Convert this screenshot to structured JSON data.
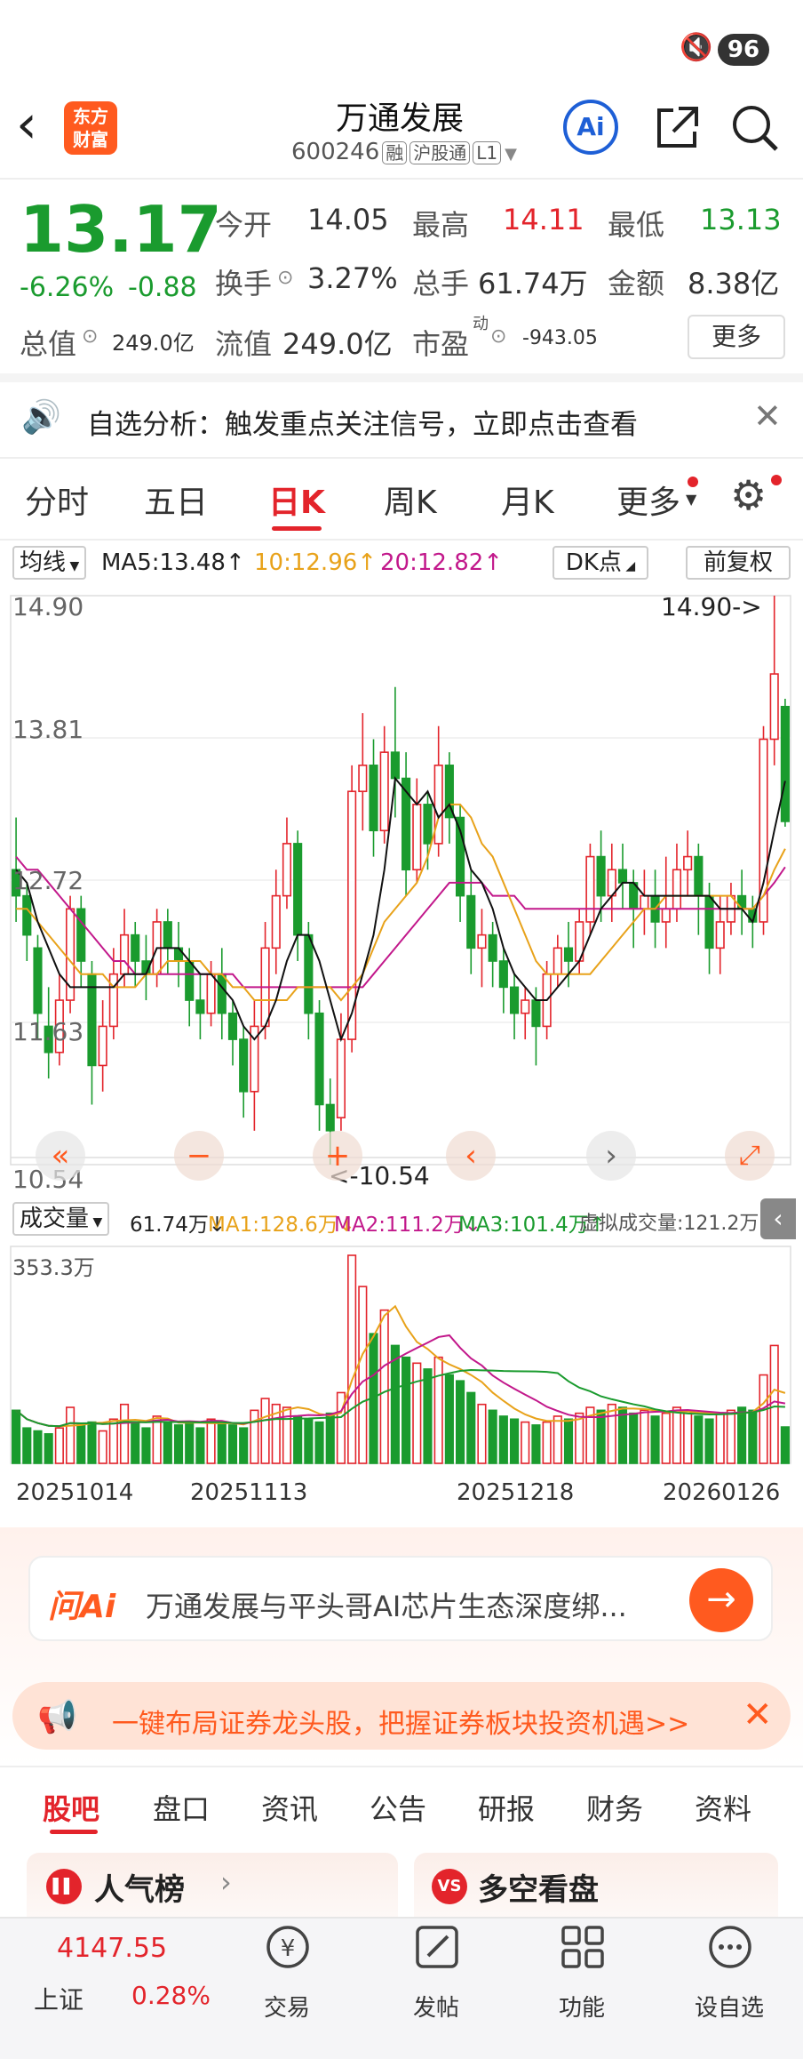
{
  "status": {
    "battery": "96"
  },
  "header": {
    "title": "万通发展",
    "code": "600246",
    "tags": [
      "融",
      "沪股通",
      "L1"
    ],
    "logo_line1": "东方",
    "logo_line2": "财富"
  },
  "quote": {
    "price": "13.17",
    "pct": "-6.26%",
    "chg": "-0.88",
    "open_label": "今开",
    "open": "14.05",
    "high_label": "最高",
    "high": "14.11",
    "low_label": "最低",
    "low": "13.13",
    "turnover_label": "换手",
    "turnover": "3.27%",
    "volume_label": "总手",
    "volume": "61.74万",
    "amount_label": "金额",
    "amount": "8.38亿",
    "mktcap_label": "总值",
    "mktcap": "249.0亿",
    "float_label": "流值",
    "float": "249.0亿",
    "pe_label": "市盈",
    "pe_sup": "动",
    "pe": "-943.05",
    "more_label": "更多"
  },
  "notice": {
    "text": "自选分析：触发重点关注信号，立即点击查看"
  },
  "tabs": [
    "分时",
    "五日",
    "日K",
    "周K",
    "月K",
    "更多"
  ],
  "active_tab": 2,
  "ma_bar": {
    "type": "均线",
    "ma5": "MA5:13.48↑",
    "ma10": "10:12.96↑",
    "ma20": "20:12.82↑",
    "dk": "DK点",
    "fq": "前复权"
  },
  "chart_labels": {
    "top": "14.90",
    "l2": "13.81",
    "l3": "12.72",
    "l4": "11.63",
    "bottom": "10.54",
    "max_note": "14.90->",
    "min_note": "<-10.54"
  },
  "vol_bar": {
    "type": "成交量",
    "vol": "61.74万↓",
    "ma1": "MA1:128.6万↓",
    "ma2": "MA2:111.2万↓",
    "ma3": "MA3:101.4万↑",
    "virtual": "虚拟成交量:121.2万",
    "max": "353.3万"
  },
  "dates": [
    "20251014",
    "20251113",
    "20251218",
    "20260126"
  ],
  "colors": {
    "up": "#e3242b",
    "down": "#1a9b2e",
    "ma5": "#111111",
    "ma10": "#e8a21a",
    "ma20": "#c2188b",
    "ma60": "#1a9b2e",
    "accent": "#ff5a1f"
  },
  "ai_box": {
    "logo": "问Ai",
    "text": "万通发展与平头哥AI芯片生态深度绑..."
  },
  "promo": {
    "text": "一键布局证券龙头股，把握证券板块投资机遇>>"
  },
  "bottom_tabs": [
    "股吧",
    "盘口",
    "资讯",
    "公告",
    "研报",
    "财务",
    "资料"
  ],
  "cards": [
    {
      "label": "人气榜",
      "icon_text": "▌▌"
    },
    {
      "label": "多空看盘",
      "icon_text": "VS"
    }
  ],
  "nav": {
    "index_value": "4147.55",
    "index_name": "上证",
    "index_pct": "0.28%",
    "items": [
      "交易",
      "发帖",
      "功能",
      "设自选"
    ]
  },
  "chart_data": {
    "type": "candlestick",
    "ylim": [
      10.54,
      14.9
    ],
    "candles": [
      [
        12.8,
        12.6,
        13.2,
        12.4
      ],
      [
        12.6,
        12.3,
        12.7,
        12.1
      ],
      [
        12.2,
        11.7,
        12.3,
        11.5
      ],
      [
        11.6,
        11.4,
        11.9,
        11.2
      ],
      [
        11.4,
        11.8,
        12.0,
        11.3
      ],
      [
        11.8,
        12.5,
        12.6,
        11.7
      ],
      [
        12.5,
        12.1,
        12.6,
        11.9
      ],
      [
        12.0,
        11.3,
        12.1,
        11.0
      ],
      [
        11.3,
        11.6,
        11.8,
        11.1
      ],
      [
        11.6,
        12.0,
        12.2,
        11.5
      ],
      [
        12.0,
        12.3,
        12.5,
        11.9
      ],
      [
        12.3,
        12.1,
        12.4,
        11.9
      ],
      [
        12.1,
        12.0,
        12.3,
        11.8
      ],
      [
        12.0,
        12.4,
        12.5,
        11.9
      ],
      [
        12.4,
        12.2,
        12.5,
        12.0
      ],
      [
        12.2,
        12.1,
        12.4,
        11.9
      ],
      [
        12.1,
        11.8,
        12.2,
        11.6
      ],
      [
        11.8,
        11.7,
        12.0,
        11.5
      ],
      [
        11.7,
        12.0,
        12.1,
        11.6
      ],
      [
        12.0,
        11.7,
        12.2,
        11.5
      ],
      [
        11.7,
        11.5,
        11.8,
        11.3
      ],
      [
        11.5,
        11.1,
        11.6,
        10.9
      ],
      [
        11.1,
        11.6,
        11.8,
        10.8
      ],
      [
        11.6,
        12.2,
        12.4,
        11.5
      ],
      [
        12.2,
        12.6,
        12.8,
        12.0
      ],
      [
        12.6,
        13.0,
        13.2,
        12.5
      ],
      [
        13.0,
        12.3,
        13.1,
        12.1
      ],
      [
        12.3,
        11.7,
        12.4,
        11.5
      ],
      [
        11.7,
        11.0,
        11.8,
        10.8
      ],
      [
        11.0,
        10.8,
        11.2,
        10.54
      ],
      [
        10.9,
        11.5,
        11.7,
        10.8
      ],
      [
        11.5,
        13.4,
        13.6,
        11.4
      ],
      [
        13.4,
        13.6,
        14.0,
        13.1
      ],
      [
        13.6,
        13.1,
        13.8,
        12.9
      ],
      [
        13.1,
        13.7,
        13.9,
        13.0
      ],
      [
        13.7,
        13.5,
        14.2,
        13.2
      ],
      [
        13.5,
        12.8,
        13.7,
        12.6
      ],
      [
        12.8,
        13.3,
        13.5,
        12.7
      ],
      [
        13.3,
        13.0,
        13.4,
        12.8
      ],
      [
        13.0,
        13.6,
        13.9,
        12.9
      ],
      [
        13.6,
        13.2,
        13.7,
        13.0
      ],
      [
        13.2,
        12.6,
        13.3,
        12.4
      ],
      [
        12.6,
        12.2,
        12.8,
        12.0
      ],
      [
        12.2,
        12.3,
        12.5,
        11.9
      ],
      [
        12.3,
        12.1,
        12.4,
        11.9
      ],
      [
        12.1,
        11.9,
        12.2,
        11.7
      ],
      [
        11.9,
        11.7,
        12.0,
        11.5
      ],
      [
        11.7,
        11.8,
        11.9,
        11.5
      ],
      [
        11.8,
        11.6,
        11.9,
        11.3
      ],
      [
        11.6,
        12.0,
        12.1,
        11.5
      ],
      [
        12.0,
        12.2,
        12.3,
        11.9
      ],
      [
        12.2,
        12.1,
        12.4,
        11.9
      ],
      [
        12.1,
        12.4,
        12.5,
        12.0
      ],
      [
        12.4,
        12.9,
        13.0,
        12.3
      ],
      [
        12.9,
        12.6,
        13.1,
        12.4
      ],
      [
        12.6,
        12.8,
        13.0,
        12.4
      ],
      [
        12.8,
        12.7,
        13.0,
        12.5
      ],
      [
        12.7,
        12.5,
        12.8,
        12.2
      ],
      [
        12.5,
        12.6,
        12.8,
        12.3
      ],
      [
        12.6,
        12.4,
        12.8,
        12.2
      ],
      [
        12.4,
        12.5,
        12.9,
        12.2
      ],
      [
        12.5,
        12.8,
        13.0,
        12.4
      ],
      [
        12.8,
        12.9,
        13.1,
        12.6
      ],
      [
        12.9,
        12.6,
        13.0,
        12.3
      ],
      [
        12.6,
        12.2,
        12.7,
        12.0
      ],
      [
        12.2,
        12.4,
        12.6,
        12.0
      ],
      [
        12.4,
        12.6,
        12.7,
        12.3
      ],
      [
        12.6,
        12.5,
        12.8,
        12.3
      ],
      [
        12.5,
        12.4,
        12.6,
        12.2
      ],
      [
        12.4,
        13.8,
        13.9,
        12.3
      ],
      [
        13.8,
        14.3,
        14.9,
        13.6
      ],
      [
        14.05,
        13.17,
        14.11,
        13.13
      ]
    ],
    "ma5": [
      12.8,
      12.7,
      12.4,
      12.2,
      12.0,
      11.9,
      11.9,
      11.9,
      11.9,
      11.9,
      12.0,
      12.0,
      12.0,
      12.2,
      12.2,
      12.2,
      12.1,
      12.0,
      12.0,
      11.9,
      11.8,
      11.6,
      11.5,
      11.6,
      11.8,
      12.1,
      12.3,
      12.3,
      12.1,
      11.8,
      11.5,
      11.7,
      12.0,
      12.3,
      12.8,
      13.5,
      13.4,
      13.3,
      13.4,
      13.2,
      13.3,
      13.1,
      12.8,
      12.7,
      12.5,
      12.2,
      12.0,
      11.9,
      11.8,
      11.8,
      11.9,
      12.0,
      12.1,
      12.3,
      12.5,
      12.6,
      12.7,
      12.7,
      12.6,
      12.6,
      12.6,
      12.6,
      12.6,
      12.6,
      12.6,
      12.5,
      12.5,
      12.5,
      12.4,
      12.7,
      13.1,
      13.48
    ],
    "ma10": [
      12.5,
      12.5,
      12.4,
      12.3,
      12.2,
      12.1,
      12.0,
      12.0,
      12.0,
      11.9,
      11.9,
      11.9,
      12.0,
      12.0,
      12.1,
      12.1,
      12.1,
      12.1,
      12.0,
      12.0,
      11.9,
      11.9,
      11.8,
      11.8,
      11.8,
      11.8,
      11.9,
      11.9,
      11.9,
      11.9,
      11.8,
      11.9,
      12.0,
      12.2,
      12.4,
      12.5,
      12.6,
      12.7,
      12.9,
      13.2,
      13.3,
      13.3,
      13.2,
      13.0,
      12.9,
      12.7,
      12.5,
      12.3,
      12.1,
      12.0,
      12.0,
      12.0,
      12.0,
      12.0,
      12.1,
      12.2,
      12.3,
      12.4,
      12.5,
      12.5,
      12.6,
      12.6,
      12.6,
      12.6,
      12.6,
      12.6,
      12.6,
      12.5,
      12.5,
      12.6,
      12.8,
      12.96
    ],
    "ma20": [
      12.9,
      12.8,
      12.8,
      12.7,
      12.6,
      12.5,
      12.4,
      12.3,
      12.2,
      12.1,
      12.1,
      12.0,
      12.0,
      12.0,
      12.0,
      12.0,
      12.0,
      12.0,
      12.0,
      12.0,
      12.0,
      11.9,
      11.9,
      11.9,
      11.9,
      11.9,
      11.9,
      11.9,
      11.9,
      11.9,
      11.9,
      11.9,
      11.9,
      12.0,
      12.1,
      12.2,
      12.3,
      12.4,
      12.5,
      12.6,
      12.7,
      12.7,
      12.7,
      12.7,
      12.6,
      12.6,
      12.6,
      12.5,
      12.5,
      12.5,
      12.5,
      12.5,
      12.5,
      12.5,
      12.5,
      12.5,
      12.5,
      12.5,
      12.5,
      12.5,
      12.5,
      12.5,
      12.5,
      12.5,
      12.5,
      12.5,
      12.5,
      12.5,
      12.5,
      12.6,
      12.7,
      12.82
    ],
    "volume": [
      90,
      60,
      55,
      50,
      60,
      95,
      65,
      70,
      55,
      75,
      100,
      70,
      60,
      80,
      70,
      65,
      70,
      60,
      75,
      70,
      65,
      60,
      90,
      110,
      100,
      95,
      80,
      75,
      70,
      85,
      120,
      353,
      300,
      220,
      260,
      200,
      180,
      170,
      160,
      180,
      150,
      140,
      120,
      100,
      90,
      80,
      75,
      70,
      65,
      70,
      80,
      75,
      85,
      95,
      90,
      100,
      95,
      85,
      90,
      80,
      85,
      95,
      90,
      80,
      75,
      85,
      90,
      95,
      90,
      150,
      200,
      61.74
    ]
  }
}
